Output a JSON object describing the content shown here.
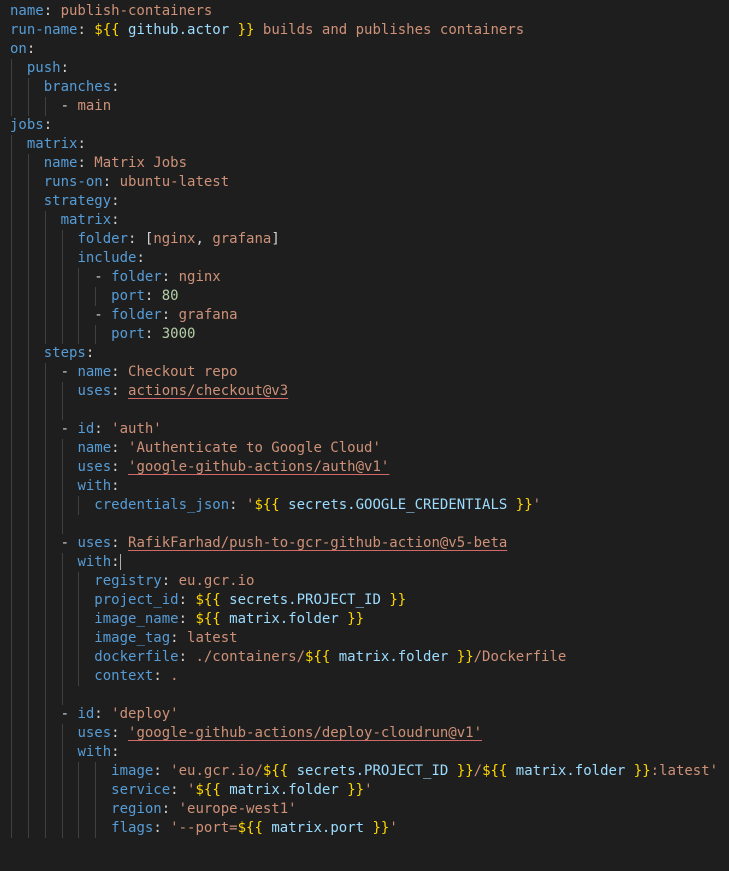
{
  "colors": {
    "background": "#1e1e1e",
    "key": "#569cd6",
    "string": "#ce9178",
    "number": "#b5cea8",
    "punctuation": "#d4d4d4",
    "braces": "#ffd700",
    "expression": "#9cdcfe",
    "guide": "#404040"
  },
  "lines": [
    {
      "indent": 0,
      "tokens": [
        [
          "k",
          "name"
        ],
        [
          "p",
          ": "
        ],
        [
          "s",
          "publish-containers"
        ]
      ]
    },
    {
      "indent": 0,
      "tokens": [
        [
          "k",
          "run-name"
        ],
        [
          "p",
          ": "
        ],
        [
          "b",
          "${{"
        ],
        [
          "v",
          " github.actor "
        ],
        [
          "b",
          "}}"
        ],
        [
          "s",
          " builds and publishes containers"
        ]
      ]
    },
    {
      "indent": 0,
      "tokens": [
        [
          "k",
          "on"
        ],
        [
          "p",
          ":"
        ]
      ]
    },
    {
      "indent": 1,
      "tokens": [
        [
          "k",
          "push"
        ],
        [
          "p",
          ":"
        ]
      ]
    },
    {
      "indent": 2,
      "tokens": [
        [
          "k",
          "branches"
        ],
        [
          "p",
          ":"
        ]
      ]
    },
    {
      "indent": 3,
      "tokens": [
        [
          "p",
          "- "
        ],
        [
          "s",
          "main"
        ]
      ]
    },
    {
      "indent": 0,
      "tokens": [
        [
          "k",
          "jobs"
        ],
        [
          "p",
          ":"
        ]
      ]
    },
    {
      "indent": 1,
      "tokens": [
        [
          "k",
          "matrix"
        ],
        [
          "p",
          ":"
        ]
      ]
    },
    {
      "indent": 2,
      "tokens": [
        [
          "k",
          "name"
        ],
        [
          "p",
          ": "
        ],
        [
          "s",
          "Matrix Jobs"
        ]
      ]
    },
    {
      "indent": 2,
      "tokens": [
        [
          "k",
          "runs-on"
        ],
        [
          "p",
          ": "
        ],
        [
          "s",
          "ubuntu-latest"
        ]
      ]
    },
    {
      "indent": 2,
      "tokens": [
        [
          "k",
          "strategy"
        ],
        [
          "p",
          ":"
        ]
      ]
    },
    {
      "indent": 3,
      "tokens": [
        [
          "k",
          "matrix"
        ],
        [
          "p",
          ":"
        ]
      ]
    },
    {
      "indent": 4,
      "tokens": [
        [
          "k",
          "folder"
        ],
        [
          "p",
          ": ["
        ],
        [
          "s",
          "nginx"
        ],
        [
          "p",
          ", "
        ],
        [
          "s",
          "grafana"
        ],
        [
          "p",
          "]"
        ]
      ]
    },
    {
      "indent": 4,
      "tokens": [
        [
          "k",
          "include"
        ],
        [
          "p",
          ":"
        ]
      ]
    },
    {
      "indent": 5,
      "tokens": [
        [
          "p",
          "- "
        ],
        [
          "k",
          "folder"
        ],
        [
          "p",
          ": "
        ],
        [
          "s",
          "nginx"
        ]
      ]
    },
    {
      "indent": 6,
      "tokens": [
        [
          "k",
          "port"
        ],
        [
          "p",
          ": "
        ],
        [
          "n",
          "80"
        ]
      ]
    },
    {
      "indent": 5,
      "tokens": [
        [
          "p",
          "- "
        ],
        [
          "k",
          "folder"
        ],
        [
          "p",
          ": "
        ],
        [
          "s",
          "grafana"
        ]
      ]
    },
    {
      "indent": 6,
      "tokens": [
        [
          "k",
          "port"
        ],
        [
          "p",
          ": "
        ],
        [
          "n",
          "3000"
        ]
      ]
    },
    {
      "indent": 2,
      "tokens": [
        [
          "k",
          "steps"
        ],
        [
          "p",
          ":"
        ]
      ]
    },
    {
      "indent": 3,
      "tokens": [
        [
          "p",
          "- "
        ],
        [
          "k",
          "name"
        ],
        [
          "p",
          ": "
        ],
        [
          "s",
          "Checkout repo"
        ]
      ]
    },
    {
      "indent": 4,
      "tokens": [
        [
          "k",
          "uses"
        ],
        [
          "p",
          ": "
        ],
        [
          "su",
          "actions/checkout@v3"
        ]
      ]
    },
    {
      "indent": 4,
      "guides": 4,
      "tokens": []
    },
    {
      "indent": 3,
      "tokens": [
        [
          "p",
          "- "
        ],
        [
          "k",
          "id"
        ],
        [
          "p",
          ": "
        ],
        [
          "s",
          "'auth'"
        ]
      ]
    },
    {
      "indent": 4,
      "tokens": [
        [
          "k",
          "name"
        ],
        [
          "p",
          ": "
        ],
        [
          "s",
          "'Authenticate to Google Cloud'"
        ]
      ]
    },
    {
      "indent": 4,
      "tokens": [
        [
          "k",
          "uses"
        ],
        [
          "p",
          ": "
        ],
        [
          "su",
          "'google-github-actions/auth@v1'"
        ]
      ]
    },
    {
      "indent": 4,
      "tokens": [
        [
          "k",
          "with"
        ],
        [
          "p",
          ":"
        ]
      ]
    },
    {
      "indent": 5,
      "tokens": [
        [
          "k",
          "credentials_json"
        ],
        [
          "p",
          ": "
        ],
        [
          "s",
          "'"
        ],
        [
          "b",
          "${{"
        ],
        [
          "v",
          " secrets.GOOGLE_CREDENTIALS "
        ],
        [
          "b",
          "}}"
        ],
        [
          "s",
          "'"
        ]
      ]
    },
    {
      "indent": 4,
      "guides": 4,
      "tokens": []
    },
    {
      "indent": 3,
      "tokens": [
        [
          "p",
          "- "
        ],
        [
          "k",
          "uses"
        ],
        [
          "p",
          ": "
        ],
        [
          "su",
          "RafikFarhad/push-to-gcr-github-action@v5-beta"
        ]
      ]
    },
    {
      "indent": 4,
      "cursor": true,
      "tokens": [
        [
          "k",
          "with"
        ],
        [
          "p",
          ":"
        ]
      ]
    },
    {
      "indent": 5,
      "tokens": [
        [
          "k",
          "registry"
        ],
        [
          "p",
          ": "
        ],
        [
          "s",
          "eu.gcr.io"
        ]
      ]
    },
    {
      "indent": 5,
      "tokens": [
        [
          "k",
          "project_id"
        ],
        [
          "p",
          ": "
        ],
        [
          "b",
          "${{"
        ],
        [
          "v",
          " secrets.PROJECT_ID "
        ],
        [
          "b",
          "}}"
        ]
      ]
    },
    {
      "indent": 5,
      "tokens": [
        [
          "k",
          "image_name"
        ],
        [
          "p",
          ": "
        ],
        [
          "b",
          "${{"
        ],
        [
          "v",
          " matrix.folder "
        ],
        [
          "b",
          "}}"
        ]
      ]
    },
    {
      "indent": 5,
      "tokens": [
        [
          "k",
          "image_tag"
        ],
        [
          "p",
          ": "
        ],
        [
          "s",
          "latest"
        ]
      ]
    },
    {
      "indent": 5,
      "tokens": [
        [
          "k",
          "dockerfile"
        ],
        [
          "p",
          ": "
        ],
        [
          "s",
          "./containers/"
        ],
        [
          "b",
          "${{"
        ],
        [
          "v",
          " matrix.folder "
        ],
        [
          "b",
          "}}"
        ],
        [
          "s",
          "/Dockerfile"
        ]
      ]
    },
    {
      "indent": 5,
      "tokens": [
        [
          "k",
          "context"
        ],
        [
          "p",
          ": "
        ],
        [
          "s",
          "."
        ]
      ]
    },
    {
      "indent": 4,
      "guides": 4,
      "tokens": []
    },
    {
      "indent": 3,
      "tokens": [
        [
          "p",
          "- "
        ],
        [
          "k",
          "id"
        ],
        [
          "p",
          ": "
        ],
        [
          "s",
          "'deploy'"
        ]
      ]
    },
    {
      "indent": 4,
      "tokens": [
        [
          "k",
          "uses"
        ],
        [
          "p",
          ": "
        ],
        [
          "su",
          "'google-github-actions/deploy-cloudrun@v1'"
        ]
      ]
    },
    {
      "indent": 4,
      "tokens": [
        [
          "k",
          "with"
        ],
        [
          "p",
          ":"
        ]
      ]
    },
    {
      "indent": 6,
      "tokens": [
        [
          "k",
          "image"
        ],
        [
          "p",
          ": "
        ],
        [
          "s",
          "'eu.gcr.io/"
        ],
        [
          "b",
          "${{"
        ],
        [
          "v",
          " secrets.PROJECT_ID "
        ],
        [
          "b",
          "}}"
        ],
        [
          "s",
          "/"
        ],
        [
          "b",
          "${{"
        ],
        [
          "v",
          " matrix.folder "
        ],
        [
          "b",
          "}}"
        ],
        [
          "s",
          ":latest'"
        ]
      ]
    },
    {
      "indent": 6,
      "tokens": [
        [
          "k",
          "service"
        ],
        [
          "p",
          ": "
        ],
        [
          "s",
          "'"
        ],
        [
          "b",
          "${{"
        ],
        [
          "v",
          " matrix.folder "
        ],
        [
          "b",
          "}}"
        ],
        [
          "s",
          "'"
        ]
      ]
    },
    {
      "indent": 6,
      "tokens": [
        [
          "k",
          "region"
        ],
        [
          "p",
          ": "
        ],
        [
          "s",
          "'europe-west1'"
        ]
      ]
    },
    {
      "indent": 6,
      "tokens": [
        [
          "k",
          "flags"
        ],
        [
          "p",
          ": "
        ],
        [
          "s",
          "'--port="
        ],
        [
          "b",
          "${{"
        ],
        [
          "v",
          " matrix.port "
        ],
        [
          "b",
          "}}"
        ],
        [
          "s",
          "'"
        ]
      ]
    }
  ]
}
